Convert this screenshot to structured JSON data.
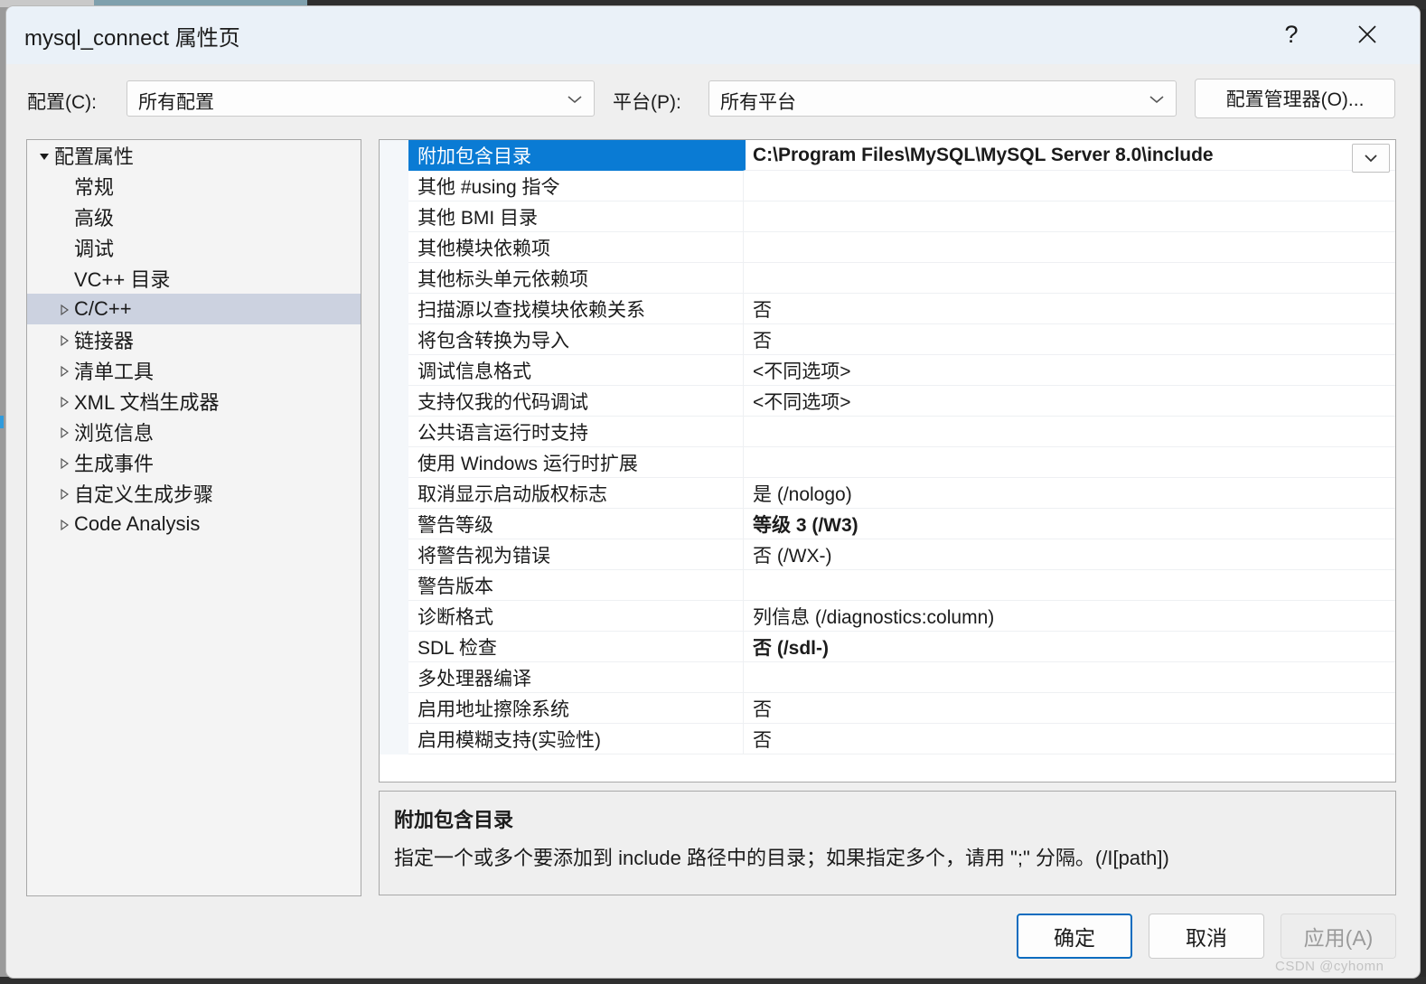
{
  "window": {
    "title": "mysql_connect 属性页",
    "help_icon": "?",
    "help_icon_name": "help-icon",
    "close_icon_name": "close-icon",
    "title_bar_color": "#eaf1f8",
    "body_color": "#efefef"
  },
  "config_bar": {
    "configuration_label": "配置(C):",
    "configuration_value": "所有配置",
    "platform_label": "平台(P):",
    "platform_value": "所有平台",
    "config_manager_button": "配置管理器(O)..."
  },
  "tree": {
    "selection_color": "#ccd2e0",
    "items": [
      {
        "label": "配置属性",
        "indent": 0,
        "twisty": "expanded",
        "selected": false
      },
      {
        "label": "常规",
        "indent": 1,
        "twisty": "none",
        "selected": false
      },
      {
        "label": "高级",
        "indent": 1,
        "twisty": "none",
        "selected": false
      },
      {
        "label": "调试",
        "indent": 1,
        "twisty": "none",
        "selected": false
      },
      {
        "label": "VC++ 目录",
        "indent": 1,
        "twisty": "none",
        "selected": false
      },
      {
        "label": "C/C++",
        "indent": 1,
        "twisty": "collapsed",
        "selected": true
      },
      {
        "label": "链接器",
        "indent": 1,
        "twisty": "collapsed",
        "selected": false
      },
      {
        "label": "清单工具",
        "indent": 1,
        "twisty": "collapsed",
        "selected": false
      },
      {
        "label": "XML 文档生成器",
        "indent": 1,
        "twisty": "collapsed",
        "selected": false
      },
      {
        "label": "浏览信息",
        "indent": 1,
        "twisty": "collapsed",
        "selected": false
      },
      {
        "label": "生成事件",
        "indent": 1,
        "twisty": "collapsed",
        "selected": false
      },
      {
        "label": "自定义生成步骤",
        "indent": 1,
        "twisty": "collapsed",
        "selected": false
      },
      {
        "label": "Code Analysis",
        "indent": 1,
        "twisty": "collapsed",
        "selected": false
      }
    ]
  },
  "grid": {
    "selection_color": "#0a7bd4",
    "dropdown_icon_name": "chevron-down-icon",
    "rows": [
      {
        "name": "附加包含目录",
        "value": "C:\\Program Files\\MySQL\\MySQL Server 8.0\\include",
        "selected": true,
        "bold": true,
        "has_dropdown": true
      },
      {
        "name": "其他 #using 指令",
        "value": "",
        "selected": false,
        "bold": false,
        "has_dropdown": false
      },
      {
        "name": "其他 BMI 目录",
        "value": "",
        "selected": false,
        "bold": false,
        "has_dropdown": false
      },
      {
        "name": "其他模块依赖项",
        "value": "",
        "selected": false,
        "bold": false,
        "has_dropdown": false
      },
      {
        "name": "其他标头单元依赖项",
        "value": "",
        "selected": false,
        "bold": false,
        "has_dropdown": false
      },
      {
        "name": "扫描源以查找模块依赖关系",
        "value": "否",
        "selected": false,
        "bold": false,
        "has_dropdown": false
      },
      {
        "name": "将包含转换为导入",
        "value": "否",
        "selected": false,
        "bold": false,
        "has_dropdown": false
      },
      {
        "name": "调试信息格式",
        "value": "<不同选项>",
        "selected": false,
        "bold": false,
        "has_dropdown": false
      },
      {
        "name": "支持仅我的代码调试",
        "value": "<不同选项>",
        "selected": false,
        "bold": false,
        "has_dropdown": false
      },
      {
        "name": "公共语言运行时支持",
        "value": "",
        "selected": false,
        "bold": false,
        "has_dropdown": false
      },
      {
        "name": "使用 Windows 运行时扩展",
        "value": "",
        "selected": false,
        "bold": false,
        "has_dropdown": false
      },
      {
        "name": "取消显示启动版权标志",
        "value": "是 (/nologo)",
        "selected": false,
        "bold": false,
        "has_dropdown": false
      },
      {
        "name": "警告等级",
        "value": "等级 3 (/W3)",
        "selected": false,
        "bold": true,
        "has_dropdown": false
      },
      {
        "name": "将警告视为错误",
        "value": "否 (/WX-)",
        "selected": false,
        "bold": false,
        "has_dropdown": false
      },
      {
        "name": "警告版本",
        "value": "",
        "selected": false,
        "bold": false,
        "has_dropdown": false
      },
      {
        "name": "诊断格式",
        "value": "列信息 (/diagnostics:column)",
        "selected": false,
        "bold": false,
        "has_dropdown": false
      },
      {
        "name": "SDL 检查",
        "value": "否 (/sdl-)",
        "selected": false,
        "bold": true,
        "has_dropdown": false
      },
      {
        "name": "多处理器编译",
        "value": "",
        "selected": false,
        "bold": false,
        "has_dropdown": false
      },
      {
        "name": "启用地址擦除系统",
        "value": "否",
        "selected": false,
        "bold": false,
        "has_dropdown": false
      },
      {
        "name": "启用模糊支持(实验性)",
        "value": "否",
        "selected": false,
        "bold": false,
        "has_dropdown": false
      }
    ]
  },
  "description": {
    "title": "附加包含目录",
    "body": "指定一个或多个要添加到 include 路径中的目录；如果指定多个，请用 \";\" 分隔。(/I[path])"
  },
  "footer": {
    "ok_label": "确定",
    "cancel_label": "取消",
    "apply_label": "应用(A)",
    "apply_disabled": true
  },
  "watermark": "CSDN @cyhomn"
}
